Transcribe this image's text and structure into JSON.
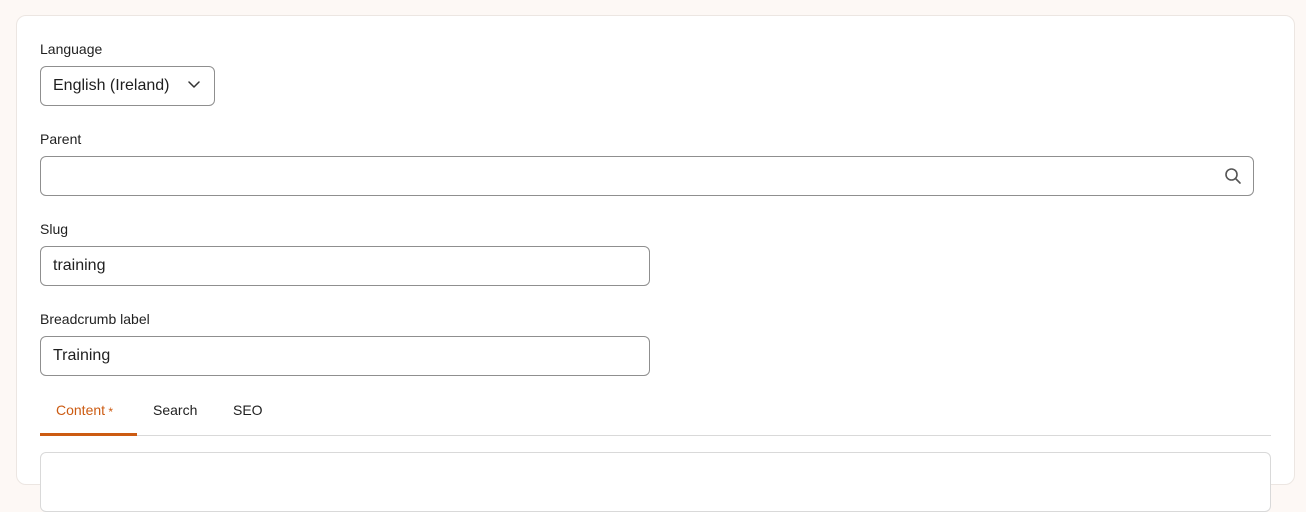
{
  "form": {
    "language": {
      "label": "Language",
      "value": "English (Ireland)"
    },
    "parent": {
      "label": "Parent",
      "value": ""
    },
    "slug": {
      "label": "Slug",
      "value": "training"
    },
    "breadcrumb": {
      "label": "Breadcrumb label",
      "value": "Training"
    }
  },
  "tabs": [
    {
      "label": "Content",
      "required": "*",
      "active": true
    },
    {
      "label": "Search",
      "active": false
    },
    {
      "label": "SEO",
      "active": false
    }
  ],
  "colors": {
    "accent": "#cc5b12",
    "border": "#8f8f8f"
  }
}
